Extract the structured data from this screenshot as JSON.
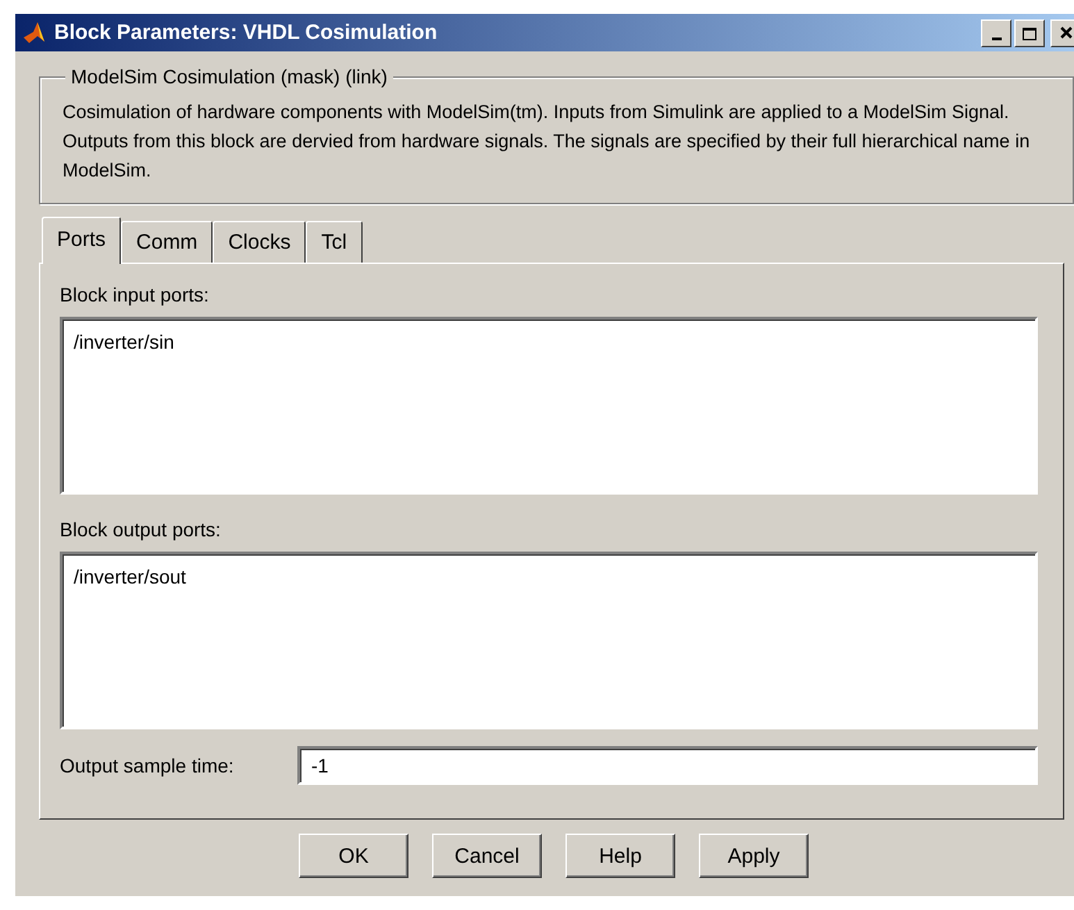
{
  "window": {
    "title": "Block Parameters: VHDL Cosimulation"
  },
  "group": {
    "title": "ModelSim Cosimulation (mask) (link)",
    "description": "Cosimulation of hardware components with ModelSim(tm).  Inputs from Simulink are applied to a ModelSim Signal.  Outputs from this block are dervied from hardware signals.  The signals are specified by their full hierarchical name in ModelSim."
  },
  "tabs": [
    {
      "label": "Ports",
      "selected": true
    },
    {
      "label": "Comm",
      "selected": false
    },
    {
      "label": "Clocks",
      "selected": false
    },
    {
      "label": "Tcl",
      "selected": false
    }
  ],
  "fields": [
    {
      "kind": "multiline",
      "label": "Block input ports:",
      "value": "/inverter/sin"
    },
    {
      "kind": "multiline",
      "label": "Block output ports:",
      "value": "/inverter/sout"
    },
    {
      "kind": "single",
      "label": "Output sample time:",
      "value": "-1"
    }
  ],
  "buttons": [
    "OK",
    "Cancel",
    "Help",
    "Apply"
  ]
}
